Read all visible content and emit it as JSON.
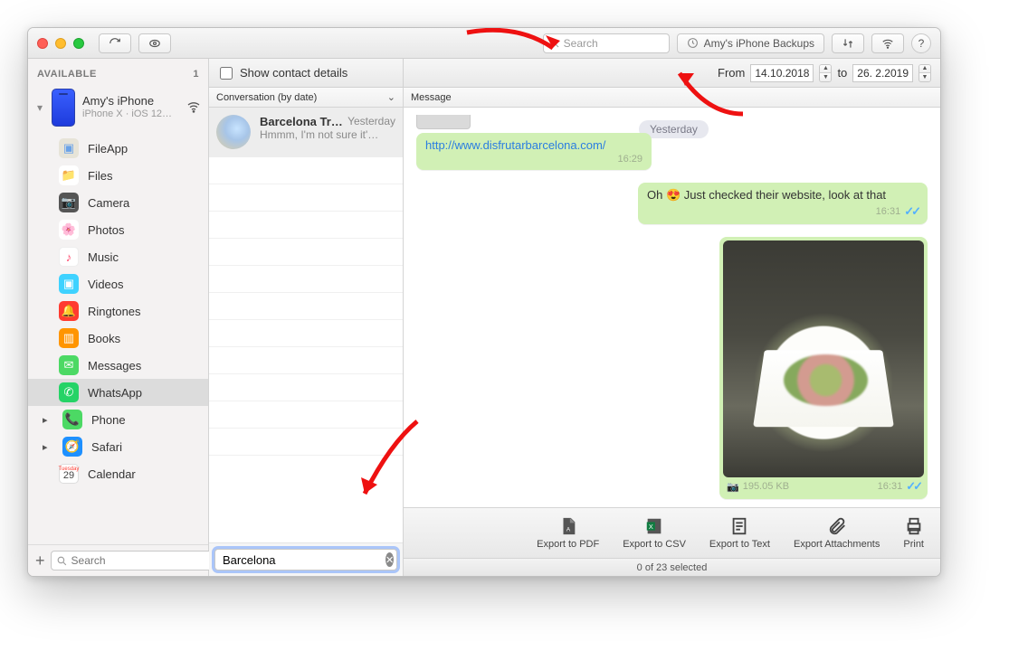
{
  "toolbar": {
    "search_placeholder": "Search",
    "backups_label": "Amy's iPhone Backups"
  },
  "sidebar": {
    "header": "AVAILABLE",
    "header_count": "1",
    "device_name": "Amy's iPhone",
    "device_sub": "iPhone X · iOS 12…",
    "items": [
      {
        "label": "FileApp",
        "color": "#e7e4d8",
        "fg": "#6aa2e8",
        "glyph": "📁"
      },
      {
        "label": "Files",
        "color": "#ffffff",
        "fg": "#2a9df4",
        "glyph": "📁"
      },
      {
        "label": "Camera",
        "color": "#555",
        "fg": "#fff",
        "glyph": "📷"
      },
      {
        "label": "Photos",
        "color": "#fff",
        "fg": "#ff8d3b",
        "glyph": "🌸"
      },
      {
        "label": "Music",
        "color": "#fff",
        "fg": "#ff4a6e",
        "glyph": "♪"
      },
      {
        "label": "Videos",
        "color": "#3fd2ff",
        "fg": "#fff",
        "glyph": "▣"
      },
      {
        "label": "Ringtones",
        "color": "#ff3b30",
        "fg": "#fff",
        "glyph": "🔔"
      },
      {
        "label": "Books",
        "color": "#ff9500",
        "fg": "#fff",
        "glyph": "▥"
      },
      {
        "label": "Messages",
        "color": "#4cd964",
        "fg": "#fff",
        "glyph": "✉"
      },
      {
        "label": "WhatsApp",
        "color": "#25d366",
        "fg": "#fff",
        "glyph": "✆"
      },
      {
        "label": "Phone",
        "color": "#4cd964",
        "fg": "#fff",
        "glyph": "📞",
        "arrow": true
      },
      {
        "label": "Safari",
        "color": "#1e90ff",
        "fg": "#fff",
        "glyph": "🧭",
        "arrow": true
      },
      {
        "label": "Calendar",
        "color": "#fff",
        "fg": "#ff3b30",
        "glyph": "29"
      }
    ],
    "search_placeholder": "Search"
  },
  "contact": {
    "checkbox_label": "Show contact details"
  },
  "date_filter": {
    "from_label": "From",
    "from_value": "14.10.2018",
    "to_label": "to",
    "to_value": "26.  2.2019"
  },
  "columns": {
    "conv": "Conversation (by date)",
    "msg": "Message"
  },
  "conversation": {
    "title": "Barcelona Tr…",
    "date": "Yesterday",
    "snippet": "Hmmm, I'm not sure it'…",
    "search_value": "Barcelona"
  },
  "chat": {
    "day": "Yesterday",
    "bubbles": {
      "link_text": "http://www.disfrutarbarcelona.com/",
      "link_time": "16:29",
      "reply_text": "Oh 😍 Just checked their website, look at that",
      "reply_time": "16:31",
      "photo_size": "195.05 KB",
      "photo_time": "16:31"
    }
  },
  "actions": {
    "pdf": "Export to PDF",
    "csv": "Export to CSV",
    "text": "Export to Text",
    "att": "Export Attachments",
    "print": "Print"
  },
  "status": "0 of 23 selected"
}
